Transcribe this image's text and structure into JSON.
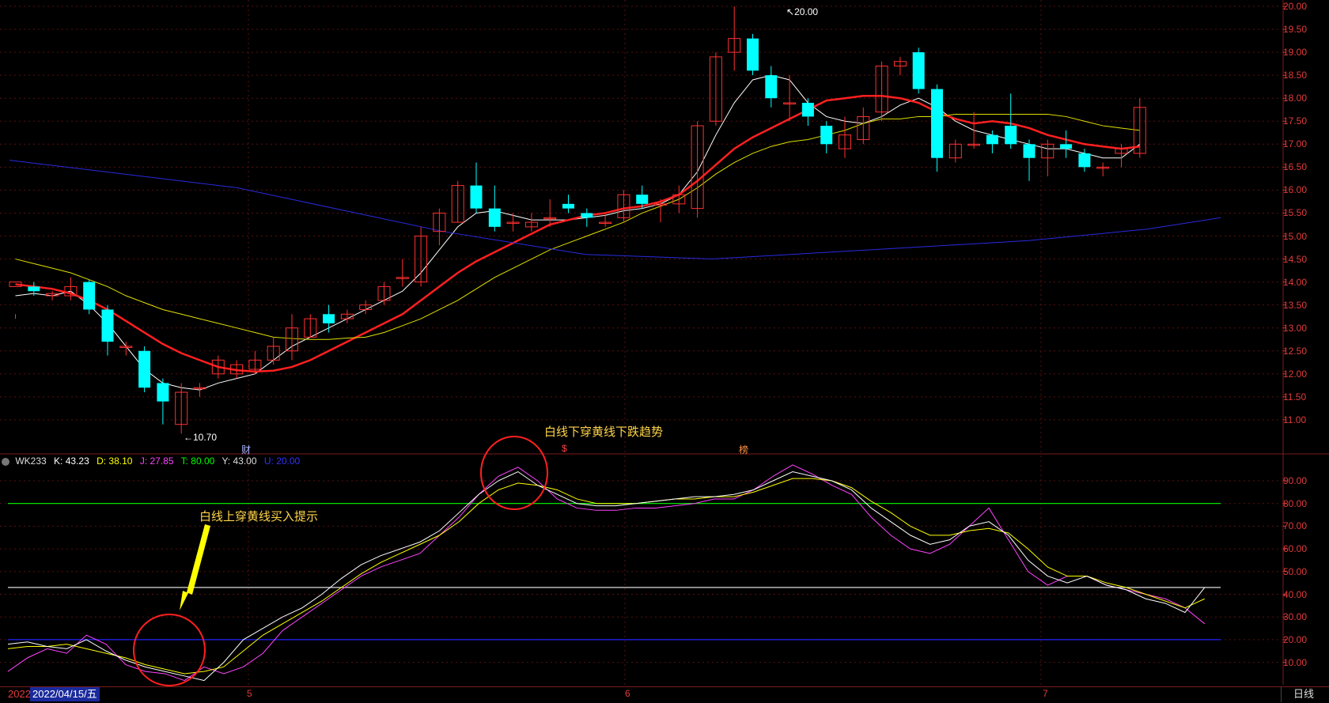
{
  "price_axis": [
    "20.00",
    "19.50",
    "19.00",
    "18.50",
    "18.00",
    "17.50",
    "17.00",
    "16.50",
    "16.00",
    "15.50",
    "15.00",
    "14.50",
    "14.00",
    "13.50",
    "13.00",
    "12.50",
    "12.00",
    "11.50",
    "11.00"
  ],
  "ind_axis": [
    "90.00",
    "80.00",
    "70.00",
    "60.00",
    "50.00",
    "40.00",
    "30.00",
    "20.00",
    "10.00"
  ],
  "peak_label": "20.00",
  "low_label": "10.70",
  "indicator": {
    "name": "WK233",
    "k": "K: 43.23",
    "d": "D: 38.10",
    "j": "J: 27.85",
    "t": "T: 80.00",
    "y": "Y: 43.00",
    "u": "U: 20.00",
    "colors": {
      "k": "#ffffff",
      "d": "#ffff00",
      "j": "#ff44ff",
      "t": "#00ff00",
      "y": "#dddddd",
      "u": "#2222ff"
    }
  },
  "annotations": {
    "sell": "白线下穿黄线下跌趋势",
    "buy": "白线上穿黄线买入提示"
  },
  "markers": {
    "m1": "财",
    "m2": "$",
    "m3": "榜"
  },
  "bottom": {
    "year": "2022",
    "date": "2022/04/15/五",
    "months": [
      "5",
      "6",
      "7"
    ],
    "period": "日线"
  },
  "colors": {
    "up": "#ff3030",
    "down": "#00ffff",
    "ma5": "#ffffff",
    "ma10": "#ff2020",
    "ma20": "#e0e000",
    "ma60": "#2a2ae0",
    "axis": "#e23b3b"
  }
}
